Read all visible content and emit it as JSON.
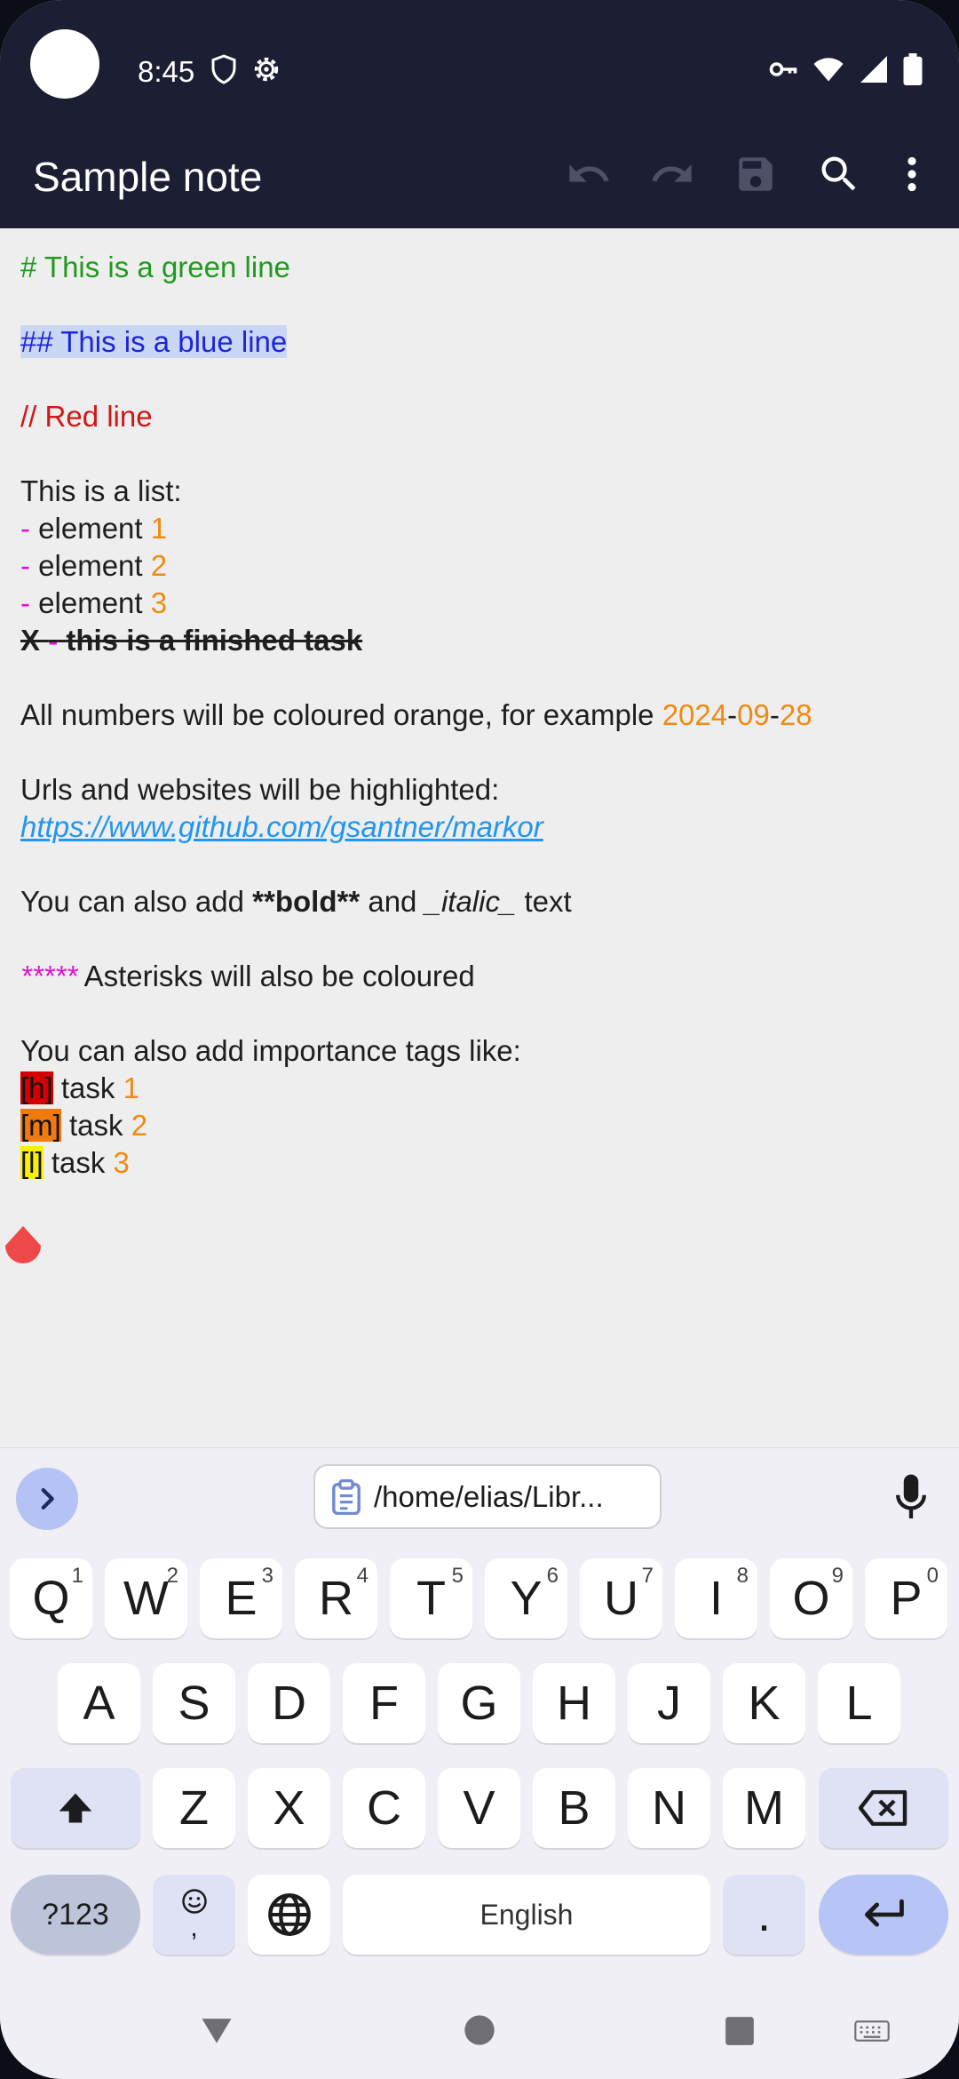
{
  "status_bar": {
    "time": "8:45"
  },
  "app_bar": {
    "title": "Sample note",
    "icons": [
      "undo-icon",
      "redo-icon",
      "save-icon",
      "search-icon",
      "more-vert-icon"
    ]
  },
  "editor": {
    "line1": "# This is a green line",
    "line2": "## This is a blue line",
    "line3": "// Red line",
    "list_title": "This is a list:",
    "dash": "-",
    "element_word": "element ",
    "elements": [
      "1",
      "2",
      "3"
    ],
    "finished_x": "X",
    "finished_text": "this is a finished task",
    "numbers_text": "All numbers will be coloured orange, for example ",
    "date_parts": [
      "2024",
      "-",
      "09",
      "-",
      "28"
    ],
    "urls_text": "Urls and websites will be highlighted:",
    "url": "https://www.github.com/gsantner/markor",
    "fmt_pre": "You can also add ",
    "fmt_bold": "**bold**",
    "fmt_mid": " and ",
    "fmt_italic": "_italic_",
    "fmt_post": " text",
    "asterisks": "*****",
    "asterisks_text": " Asterisks will also be coloured",
    "tags_title": "You can also add importance tags like:",
    "tags": [
      {
        "tag": "[h]",
        "text": " task ",
        "num": "1"
      },
      {
        "tag": "[m]",
        "text": " task ",
        "num": "2"
      },
      {
        "tag": "[l]",
        "text": " task ",
        "num": "3"
      }
    ],
    "colors": {
      "green": "#1f9a1f",
      "blue": "#1e25d6",
      "red": "#cf1818",
      "magenta": "#e010d8",
      "orange": "#f08a10",
      "link": "#2196f3"
    }
  },
  "keyboard": {
    "clipboard_chip": "/home/elias/Libr...",
    "row1": [
      {
        "k": "Q",
        "n": "1"
      },
      {
        "k": "W",
        "n": "2"
      },
      {
        "k": "E",
        "n": "3"
      },
      {
        "k": "R",
        "n": "4"
      },
      {
        "k": "T",
        "n": "5"
      },
      {
        "k": "Y",
        "n": "6"
      },
      {
        "k": "U",
        "n": "7"
      },
      {
        "k": "I",
        "n": "8"
      },
      {
        "k": "O",
        "n": "9"
      },
      {
        "k": "P",
        "n": "0"
      }
    ],
    "row2": [
      "A",
      "S",
      "D",
      "F",
      "G",
      "H",
      "J",
      "K",
      "L"
    ],
    "row3": [
      "Z",
      "X",
      "C",
      "V",
      "B",
      "N",
      "M"
    ],
    "symbols_key": "?123",
    "emoji_comma": ",",
    "space_label": "English",
    "period_key": "."
  }
}
